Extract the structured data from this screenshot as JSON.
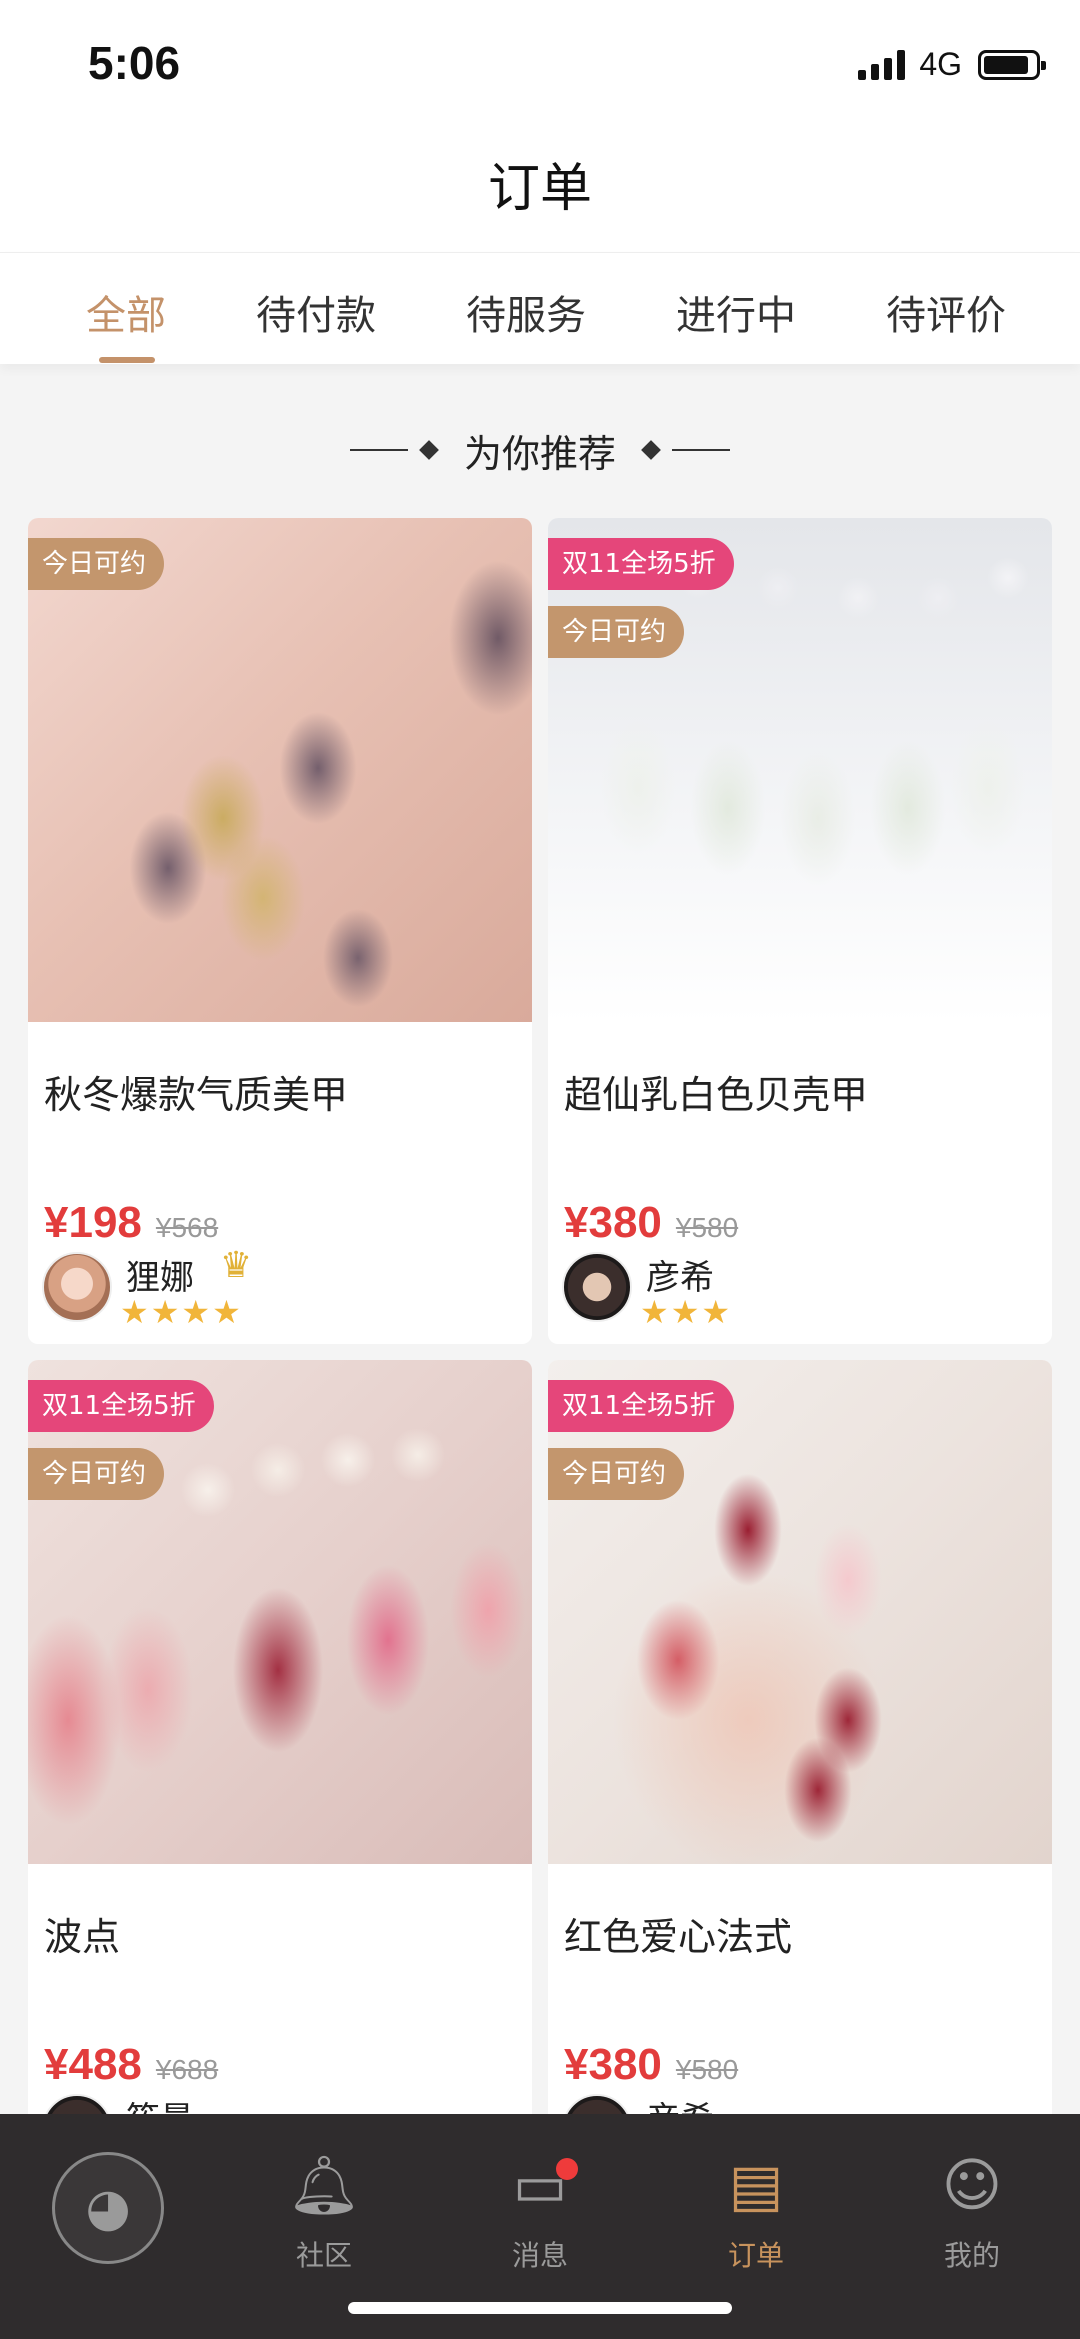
{
  "status_bar": {
    "time": "5:06",
    "network": "4G"
  },
  "header": {
    "title": "订单"
  },
  "tabs": [
    {
      "label": "全部",
      "active": true
    },
    {
      "label": "待付款",
      "active": false
    },
    {
      "label": "待服务",
      "active": false
    },
    {
      "label": "进行中",
      "active": false
    },
    {
      "label": "待评价",
      "active": false
    }
  ],
  "recommend": {
    "title": "为你推荐"
  },
  "cards": [
    {
      "badges": [
        "今日可约"
      ],
      "title": "秋冬爆款气质美甲",
      "price": "¥198",
      "original_price": "¥568",
      "author": "狸娜",
      "vip": true,
      "stars": 4
    },
    {
      "badges": [
        "双11全场5折",
        "今日可约"
      ],
      "title": "超仙乳白色贝壳甲",
      "price": "¥380",
      "original_price": "¥580",
      "author": "彦希",
      "vip": false,
      "stars": 3
    },
    {
      "badges": [
        "双11全场5折",
        "今日可约"
      ],
      "title": "波点",
      "price": "¥488",
      "original_price": "¥688",
      "author": "筱曼"
    },
    {
      "badges": [
        "双11全场5折",
        "今日可约"
      ],
      "title": "红色爱心法式",
      "price": "¥380",
      "original_price": "¥580",
      "author": "彦希"
    }
  ],
  "bottom_nav": [
    {
      "label": "社区",
      "icon": "bell-icon",
      "active": false
    },
    {
      "label": "消息",
      "icon": "chat-icon",
      "active": false,
      "badge_dot": true
    },
    {
      "label": "订单",
      "icon": "clipboard-icon",
      "active": true
    },
    {
      "label": "我的",
      "icon": "face-icon",
      "active": false
    }
  ],
  "colors": {
    "accent": "#c4926a",
    "price": "#e23c3c",
    "promo_badge": "#e5467a",
    "today_badge": "#c3966d",
    "nav_bg": "#2f2c2d"
  }
}
